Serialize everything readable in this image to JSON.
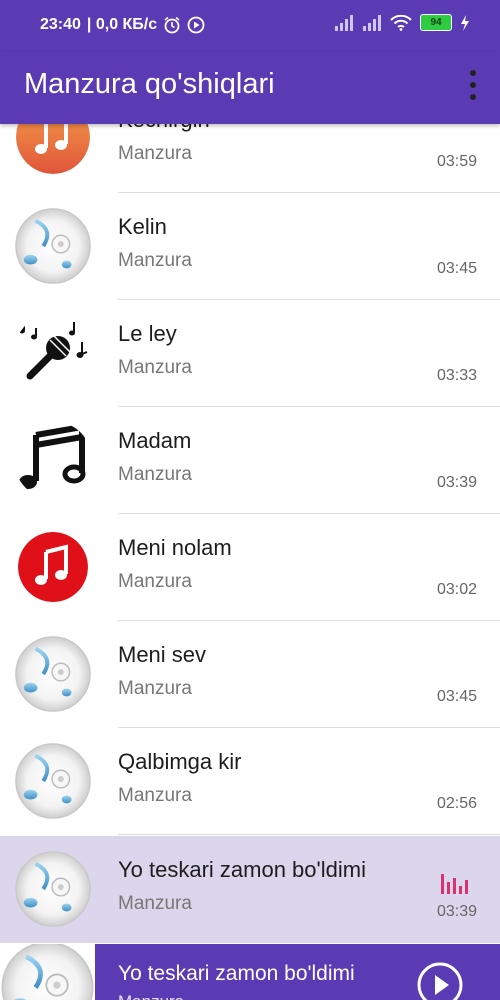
{
  "status": {
    "time": "23:40",
    "network": "| 0,0 КБ/с",
    "battery": "94"
  },
  "app": {
    "title": "Manzura qo'shiqlari"
  },
  "songs": [
    {
      "title": "Kechirgin",
      "artist": "Manzura",
      "duration": "03:59",
      "icon": "orange-music-note-icon"
    },
    {
      "title": "Kelin",
      "artist": "Manzura",
      "duration": "03:45",
      "icon": "music-disc-icon"
    },
    {
      "title": "Le ley",
      "artist": "Manzura",
      "duration": "03:33",
      "icon": "microphone-notes-icon"
    },
    {
      "title": "Madam",
      "artist": "Manzura",
      "duration": "03:39",
      "icon": "black-music-note-icon"
    },
    {
      "title": "Meni nolam",
      "artist": "Manzura",
      "duration": "03:02",
      "icon": "red-music-note-icon"
    },
    {
      "title": "Meni sev",
      "artist": "Manzura",
      "duration": "03:45",
      "icon": "music-disc-icon"
    },
    {
      "title": "Qalbimga kir",
      "artist": "Manzura",
      "duration": "02:56",
      "icon": "music-disc-icon"
    },
    {
      "title": "Yo teskari zamon bo'ldimi",
      "artist": "Manzura",
      "duration": "03:39",
      "icon": "music-disc-icon",
      "playing": true
    }
  ],
  "player": {
    "title": "Yo teskari zamon bo'ldimi",
    "artist": "Manzura",
    "state": "paused"
  },
  "colors": {
    "primary": "#5b3bb4",
    "active_row": "#dcd6ec",
    "equalizer": "#d8336f"
  }
}
